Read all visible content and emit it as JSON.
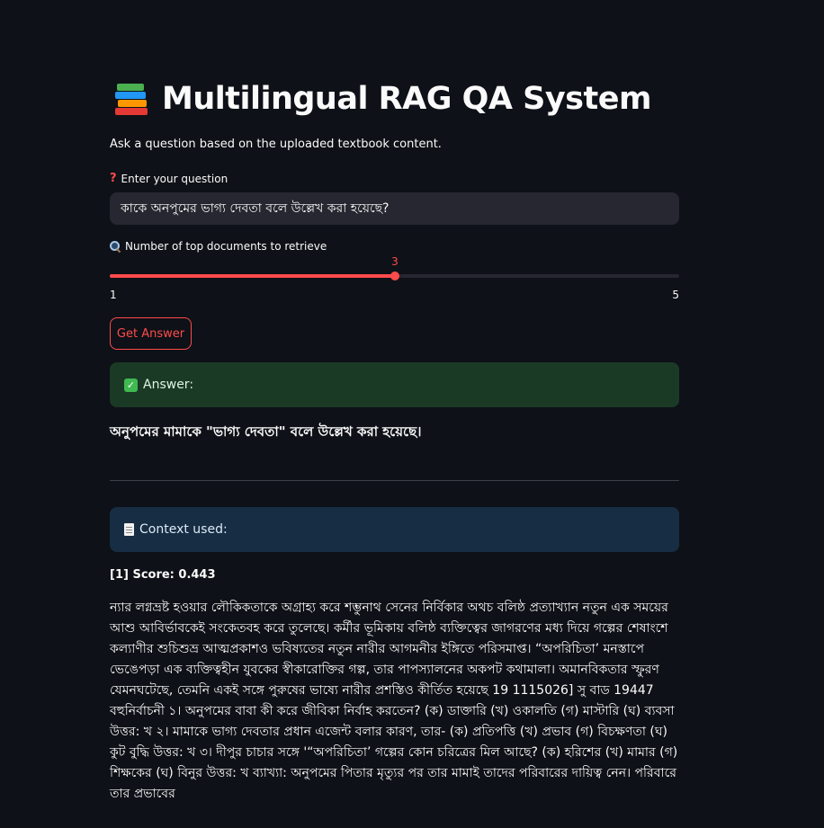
{
  "header": {
    "icon": "books-icon",
    "title": "Multilingual RAG QA System",
    "caption": "Ask a question based on the uploaded textbook content."
  },
  "question": {
    "label": "Enter your question",
    "value": "কাকে অনপুমের ভাগ্য দেবতা বলে উল্লেখ করা হয়েছে?"
  },
  "slider": {
    "label": "Number of top documents to retrieve",
    "value": "3",
    "min": "1",
    "max": "5",
    "fraction": 0.5
  },
  "button": {
    "label": "Get Answer"
  },
  "answer": {
    "heading": "Answer:",
    "text": "অনুপমের মামাকে \"ভাগ্য দেবতা\" বলে উল্লেখ করা হয়েছে।"
  },
  "context": {
    "heading": "Context used:",
    "items": [
      {
        "score": "[1] Score: 0.443",
        "text": "ন্যার লগ্নভ্রষ্ট হওয়ার লৌকিকতাকে অগ্রাহ্য করে শম্ভুনাথ সেনের নির্বিকার অথচ বলিষ্ঠ প্রত্যাখ্যান নতুন এক সময়ের আশু আবির্ভাবকেই সংকেতবহ করে তুলেছে। কর্মীর ভূমিকায় বলিষ্ঠ ব্যক্তিত্বের জাগরণের মধ্য দিয়ে গল্পের শেষাংশে কল্যাণীর শুচিশুভ্র আত্মপ্রকাশও ভবিষ্যতের নতুন নারীর আগমনীর ইঙ্গিতে পরিসমাপ্ত। “অপরিচিতা’ মনস্তাপে ভেঙেপড়া এক ব্যক্তিত্বহীন যুবকের স্বীকারোক্তির গল্প, তার পাপস্যালনের অকপট কথামালা। অমানবিকতার স্ফুরণ যেমনঘটেছে, তেমনি একই সঙ্গে পুরুষের ভাষ্যে নারীর প্রশস্তিও কীর্তিত হয়েছে 19 1115026] সু বাড 19447 বহুনির্বাচনী ১। অনুপমের বাবা কী করে জীবিকা নির্বাহ করতেন? (ক) ডাক্তারি (খ) ওকালতি (গ) মাস্টারি (ঘ) ব্যবসা উত্তর: খ ২। মামাকে ভাগ্য দেবতার প্রধান এজেন্ট বলার কারণ, তার- (ক) প্রতিপত্তি (খ) প্রভাব (গ) বিচক্ষণতা (ঘ) কুট বুদ্ধি উত্তর: খ ৩। দীপুর চাচার সঙ্গে '“অপরিচিতা’ গল্পের কোন চরিত্রের মিল আছে? (ক) হরিশের (খ) মামার (গ) শিক্ষকের (ঘ) বিনুর উত্তর: খ ব্যাখ্যা: অনুপমের পিতার মৃত্যুর পর তার মামাই তাদের পরিবারের দায়িত্ব নেন। পরিবারে তার প্রভাবের"
      }
    ]
  },
  "colors": {
    "background": "#0e1117",
    "accent": "#ff4b4b",
    "success_bg": "#1b3a26",
    "info_bg": "#172d43"
  }
}
